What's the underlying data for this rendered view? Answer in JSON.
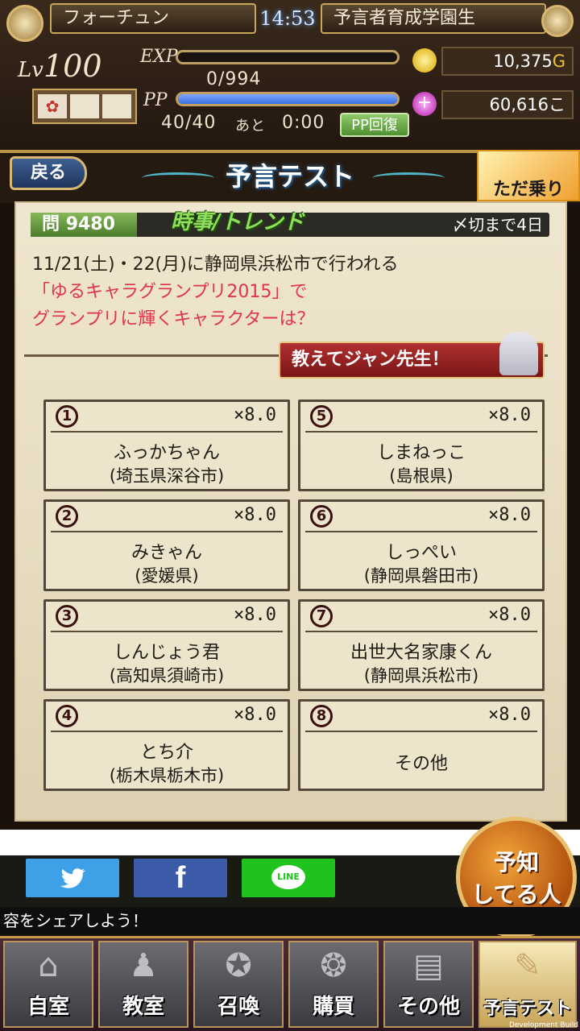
{
  "header": {
    "player_name": "フォーチュン",
    "clock": "14:53",
    "rank_title": "予言者育成学園生",
    "level_prefix": "Lv",
    "level": "100",
    "exp_label": "EXP",
    "exp_value": "0/994",
    "exp_fraction": 0.0,
    "pp_label": "PP",
    "pp_value": "40/40",
    "pp_fraction": 1.0,
    "pp_recover_prefix": "あと",
    "pp_recover_time": "0:00",
    "pp_recover_button": "PP回復",
    "gold": "10,375",
    "gold_unit": "G",
    "gems": "60,616",
    "gems_unit": "こ"
  },
  "titlebar": {
    "back_label": "戻る",
    "title": "予言テスト",
    "free_ride_label": "ただ乗り"
  },
  "question": {
    "number_label": "問",
    "number": "9480",
    "genre": "時事/トレンド",
    "deadline": "〆切まで4日",
    "line1": "11/21(土)・22(月)に静岡県浜松市で行われる",
    "line2": "「ゆるキャラグランプリ2015」で",
    "line3": "グランプリに輝くキャラクターは？",
    "teacher_button": "教えてジャン先生！"
  },
  "options": [
    {
      "num": "1",
      "odds": "×8.0",
      "name": "ふっかちゃん",
      "place": "(埼玉県深谷市)"
    },
    {
      "num": "2",
      "odds": "×8.0",
      "name": "みきゃん",
      "place": "(愛媛県)"
    },
    {
      "num": "3",
      "odds": "×8.0",
      "name": "しんじょう君",
      "place": "(高知県須崎市)"
    },
    {
      "num": "4",
      "odds": "×8.0",
      "name": "とち介",
      "place": "(栃木県栃木市)"
    },
    {
      "num": "5",
      "odds": "×8.0",
      "name": "しまねっこ",
      "place": "(島根県)"
    },
    {
      "num": "6",
      "odds": "×8.0",
      "name": "しっぺい",
      "place": "(静岡県磐田市)"
    },
    {
      "num": "7",
      "odds": "×8.0",
      "name": "出世大名家康くん",
      "place": "(静岡県浜松市)"
    },
    {
      "num": "8",
      "odds": "×8.0",
      "name": "その他",
      "place": ""
    }
  ],
  "share": {
    "twitter_icon": "twitter-bird-icon",
    "facebook_label": "f",
    "line_label": "LINE",
    "marquee": "容をシェアしよう！",
    "predict_button_line1": "予知",
    "predict_button_line2": "してる人"
  },
  "nav": [
    {
      "label": "自室",
      "icon": "room-icon"
    },
    {
      "label": "教室",
      "icon": "classroom-icon"
    },
    {
      "label": "召喚",
      "icon": "summon-circle-icon"
    },
    {
      "label": "購買",
      "icon": "shop-icon"
    },
    {
      "label": "その他",
      "icon": "other-icon"
    },
    {
      "label": "予言テスト",
      "icon": "prophecy-test-icon"
    }
  ],
  "footer_note": "Development Build",
  "colors": {
    "accent_red": "#e0344a",
    "genre_green": "#8ee05a",
    "exp_bar": "#5a5a5a",
    "pp_bar": "#3a6fe0",
    "twitter": "#3ea0e6",
    "facebook": "#3b5ba8",
    "line": "#1ec31e"
  }
}
